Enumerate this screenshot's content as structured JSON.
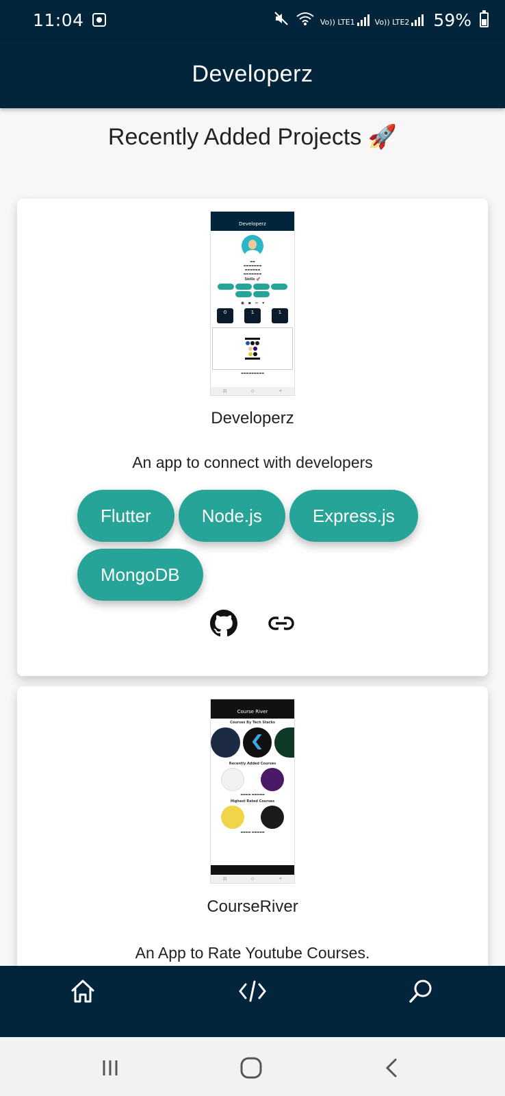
{
  "status_bar": {
    "time": "11:04",
    "sim1": "Vo)) LTE1",
    "sim2": "Vo)) LTE2",
    "battery": "59%"
  },
  "app_bar": {
    "title": "Developerz"
  },
  "section": {
    "title": "Recently Added Projects 🚀"
  },
  "projects": [
    {
      "name": "Developerz",
      "description": "An app to connect with developers",
      "tags": [
        "Flutter",
        "Node.js",
        "Express.js",
        "MongoDB"
      ],
      "screenshot": {
        "title": "Developerz",
        "skills_label": "Skills 🚀",
        "stats": [
          "0",
          "1",
          "1"
        ]
      }
    },
    {
      "name": "CourseRiver",
      "description": "An App to Rate Youtube Courses.",
      "screenshot": {
        "title": "Course River",
        "heading_1": "Courses By Tech Stacks",
        "heading_2": "Recently Added Courses",
        "heading_3": "Highest Rated Courses"
      }
    }
  ],
  "icons": {
    "github": "github-icon",
    "link": "link-icon",
    "home": "home-icon",
    "code": "code-icon",
    "search": "search-icon"
  },
  "colors": {
    "primary_dark": "#02253b",
    "chip": "#26a498",
    "background": "#f7f7f7"
  }
}
